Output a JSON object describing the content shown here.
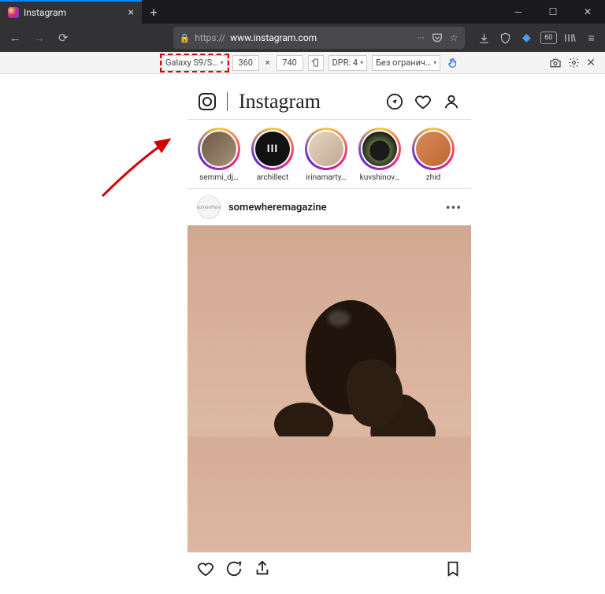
{
  "browser": {
    "tab_title": "Instagram",
    "url_scheme": "https://",
    "url_domain": "www.instagram.com",
    "url_ellipsis": "···",
    "toolbar_badge": "60"
  },
  "devtools": {
    "device": "Galaxy S9/S…",
    "width": "360",
    "sep": "×",
    "height": "740",
    "dpr_label": "DPR: 4",
    "throttle": "Без огранич…"
  },
  "instagram": {
    "logo": "Instagram",
    "stories": [
      {
        "label": "semmi_dj…"
      },
      {
        "label": "archillect"
      },
      {
        "label": "irinamarty…"
      },
      {
        "label": "kuvshinov…"
      },
      {
        "label": "zhid"
      }
    ],
    "post": {
      "avatar_text": "somewhere",
      "username": "somewheremagazine"
    }
  }
}
